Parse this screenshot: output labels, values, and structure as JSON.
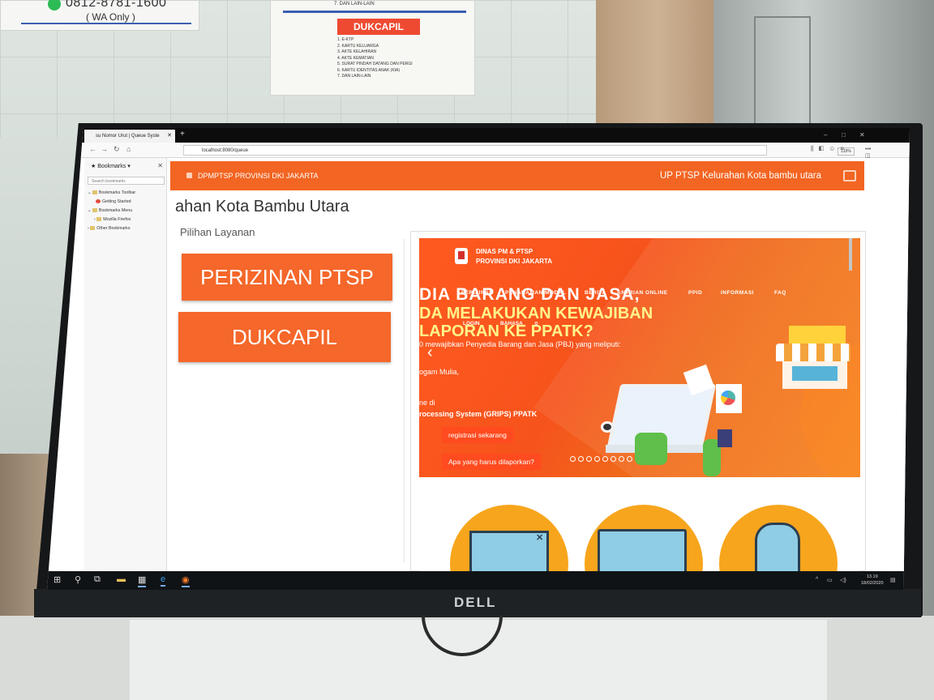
{
  "poster_left": {
    "phone": "0812-8781-1600",
    "note": "( WA Only )"
  },
  "poster_right": {
    "top_item": "7.   DAN LAIN-LAIN",
    "heading": "DUKCAPIL",
    "items": [
      "1.   E-KTP",
      "2.   KARTU KELUARGA",
      "3.   AKTE KELAHIRAN",
      "4.   AKTE KEMATIAN",
      "5.   SURAT PINDAH DATANG DAN PERGI",
      "6.   KARTU IDENTITAS ANAK (KIA)",
      "7.   DAN LAIN-LAIN"
    ]
  },
  "monitor_brand": "DELL",
  "browser": {
    "tab_title": "su Nomor Urut | Queue Syste",
    "new_tab": "+",
    "url": "localhost:8080/queue",
    "zoom": "133%",
    "window_controls": [
      "–",
      "□",
      "✕"
    ]
  },
  "sidebar": {
    "title": "Bookmarks",
    "search_placeholder": "Search bookmarks",
    "items": [
      "Bookmarks Toolbar",
      "Getting Started",
      "Bookmarks Menu",
      "Mozilla Firefox",
      "Other Bookmarks"
    ]
  },
  "app": {
    "brand": "DPMPTSP PROVINSI  DKI JAKARTA",
    "location": "UP PTSP Kelurahan Kota bambu utara",
    "page_title": "ahan Kota Bambu Utara",
    "section_label": "Pilihan Layanan",
    "services": [
      "PERIZINAN PTSP",
      "DUKCAPIL"
    ]
  },
  "embedded_site": {
    "org_line1": "DINAS PM & PTSP",
    "org_line2": "PROVINSI DKI JAKARTA",
    "menu": [
      "PERIZINAN",
      "PENANAMAN MODAL",
      "BERITA",
      "ANTRIAN ONLINE",
      "PPID",
      "INFORMASI",
      "FAQ"
    ],
    "menu_row2": [
      "LOGIN",
      "BAHASA"
    ],
    "headline1": "DIA BARANG DAN JASA,",
    "headline2": "DA MELAKUKAN KEWAJIBAN",
    "headline3": "LAPORAN KE PPATK?",
    "para1": "0 mewajibkan Penyedia Barang dan Jasa (PBJ) yang meliputi:",
    "para2": "ogam Mulia,",
    "para3": "ne di",
    "para4": "rocessing System (GRIPS) PPATK",
    "cta1": "registrasi sekarang",
    "cta2": "Apa yang harus dilaporkan?"
  },
  "taskbar": {
    "time": "13.19",
    "date": "18/02/2020"
  }
}
